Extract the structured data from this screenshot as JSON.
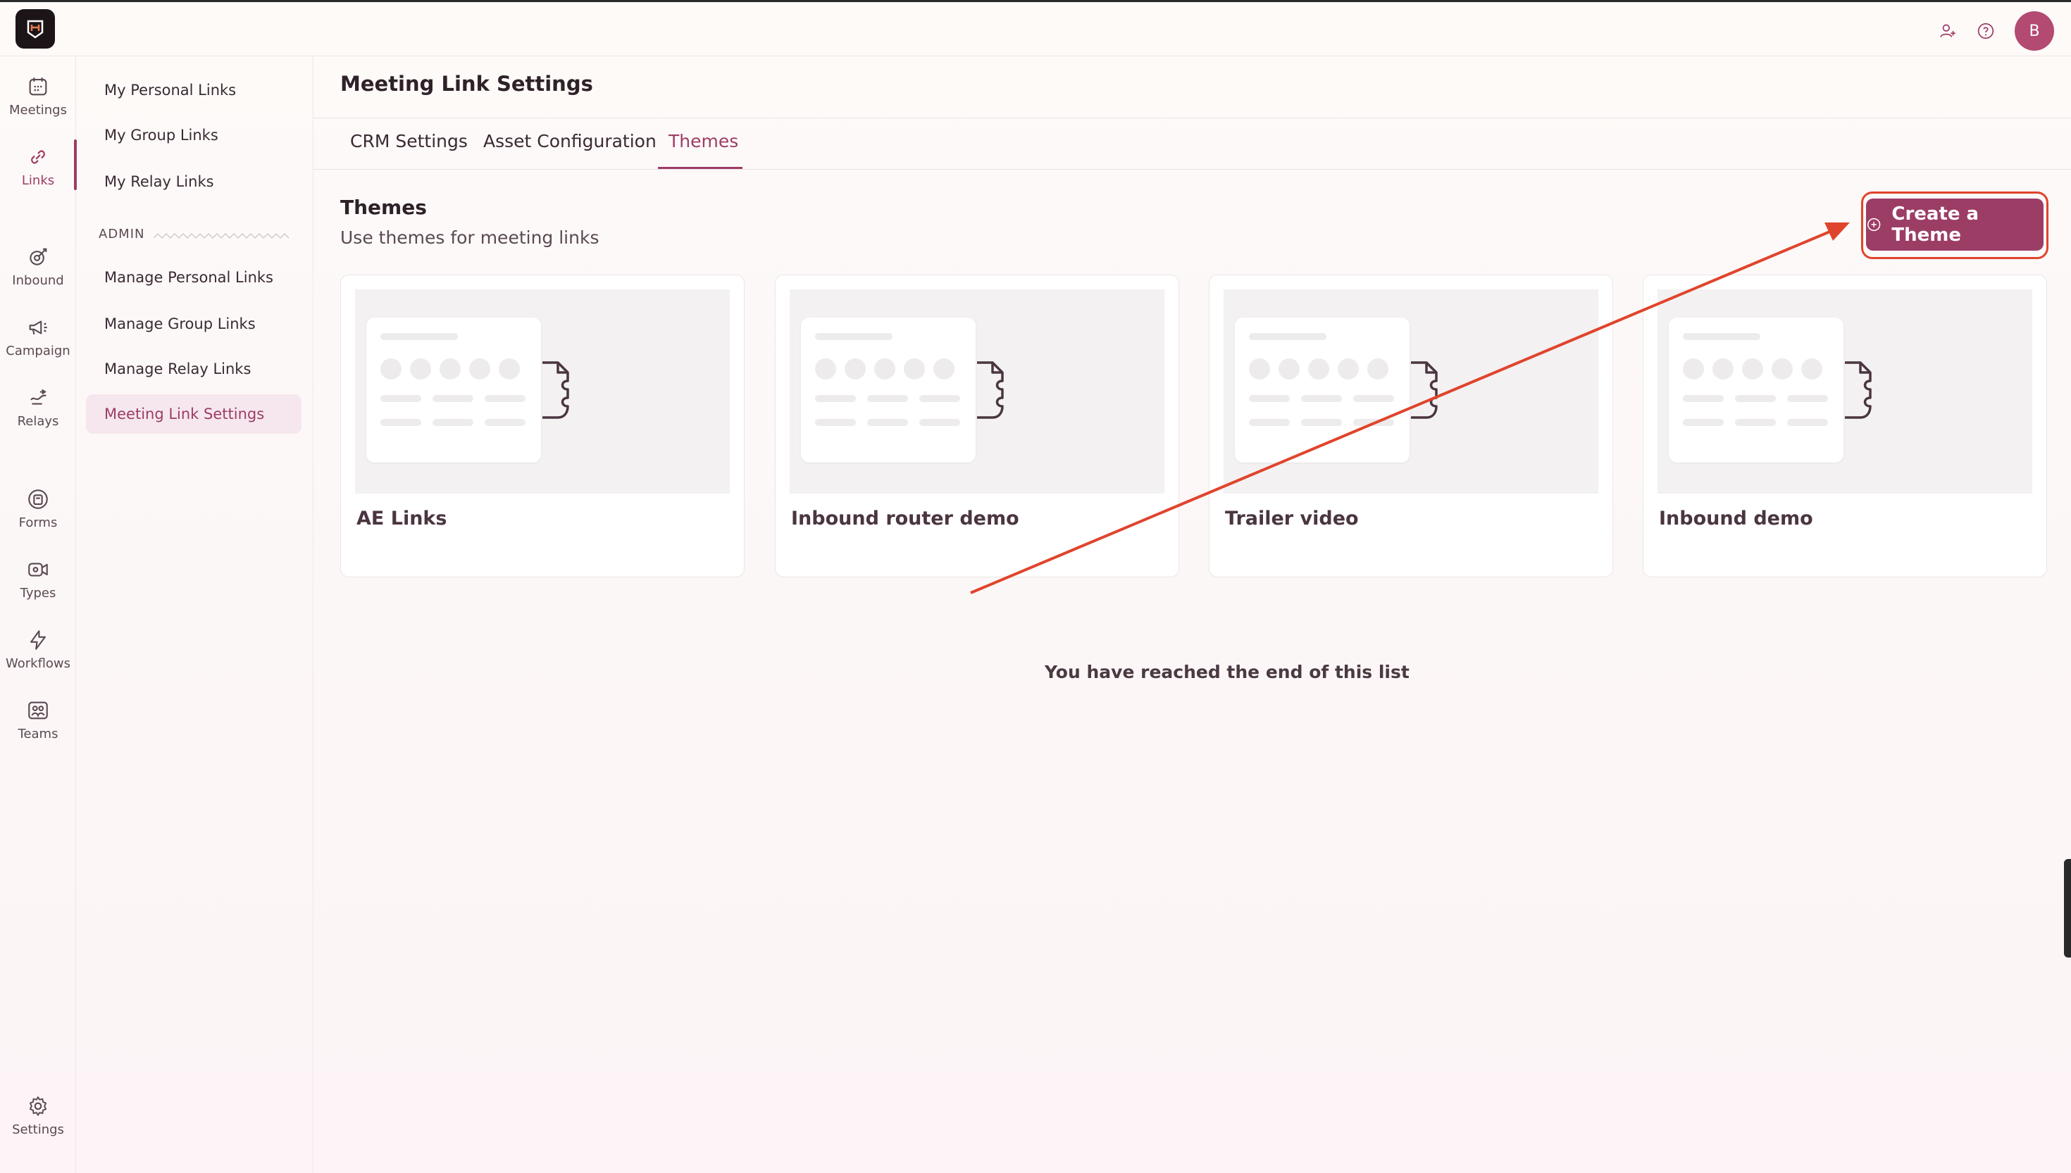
{
  "topbar": {
    "avatar_initial": "B",
    "icons": [
      "add-user-icon",
      "help-icon"
    ]
  },
  "rail": [
    {
      "label": "Meetings",
      "icon": "calendar-icon"
    },
    {
      "label": "Links",
      "icon": "link-icon"
    },
    {
      "label": "Inbound",
      "icon": "inbound-icon"
    },
    {
      "label": "Campaign",
      "icon": "megaphone-icon"
    },
    {
      "label": "Relays",
      "icon": "relay-icon"
    },
    {
      "label": "Forms",
      "icon": "form-icon"
    },
    {
      "label": "Types",
      "icon": "video-icon"
    },
    {
      "label": "Workflows",
      "icon": "bolt-icon"
    },
    {
      "label": "Teams",
      "icon": "team-icon"
    },
    {
      "label": "Settings",
      "icon": "gear-icon"
    }
  ],
  "subnav": {
    "items": [
      "My Personal Links",
      "My Group Links",
      "My Relay Links"
    ],
    "admin_label": "ADMIN",
    "admin_items": [
      "Manage Personal Links",
      "Manage Group Links",
      "Manage Relay Links",
      "Meeting Link Settings"
    ]
  },
  "page": {
    "title": "Meeting Link Settings",
    "tabs": [
      "CRM Settings",
      "Asset Configuration",
      "Themes"
    ],
    "section_title": "Themes",
    "section_subtitle": "Use themes for meeting links",
    "create_button": "Create a Theme",
    "cards": [
      "AE Links",
      "Inbound router demo",
      "Trailer video",
      "Inbound demo"
    ],
    "end_text": "You have reached the end of this list"
  },
  "colors": {
    "accent": "#9c3d66",
    "annotation": "#e0442c"
  }
}
